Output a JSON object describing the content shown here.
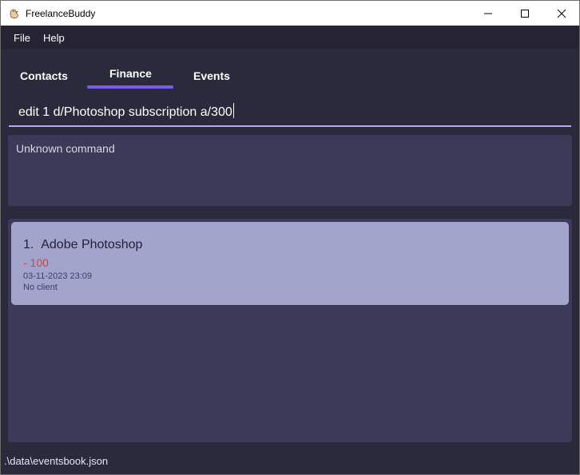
{
  "window": {
    "title": "FreelanceBuddy"
  },
  "menu": {
    "file_label": "File",
    "help_label": "Help"
  },
  "tabs": [
    {
      "label": "Contacts",
      "active": false
    },
    {
      "label": "Finance",
      "active": true
    },
    {
      "label": "Events",
      "active": false
    }
  ],
  "command": {
    "value": "edit 1 d/Photoshop subscription a/300"
  },
  "result": {
    "message": "Unknown command"
  },
  "finance_list": [
    {
      "index": "1.",
      "description": "Adobe Photoshop",
      "amount": "- 100",
      "timestamp": "03-11-2023 23:09",
      "client": "No client"
    }
  ],
  "status": {
    "file_path": ".\\data\\eventsbook.json"
  },
  "colors": {
    "accent": "#7b5cf0",
    "expense": "#d2453d",
    "card": "#a2a4cc"
  }
}
